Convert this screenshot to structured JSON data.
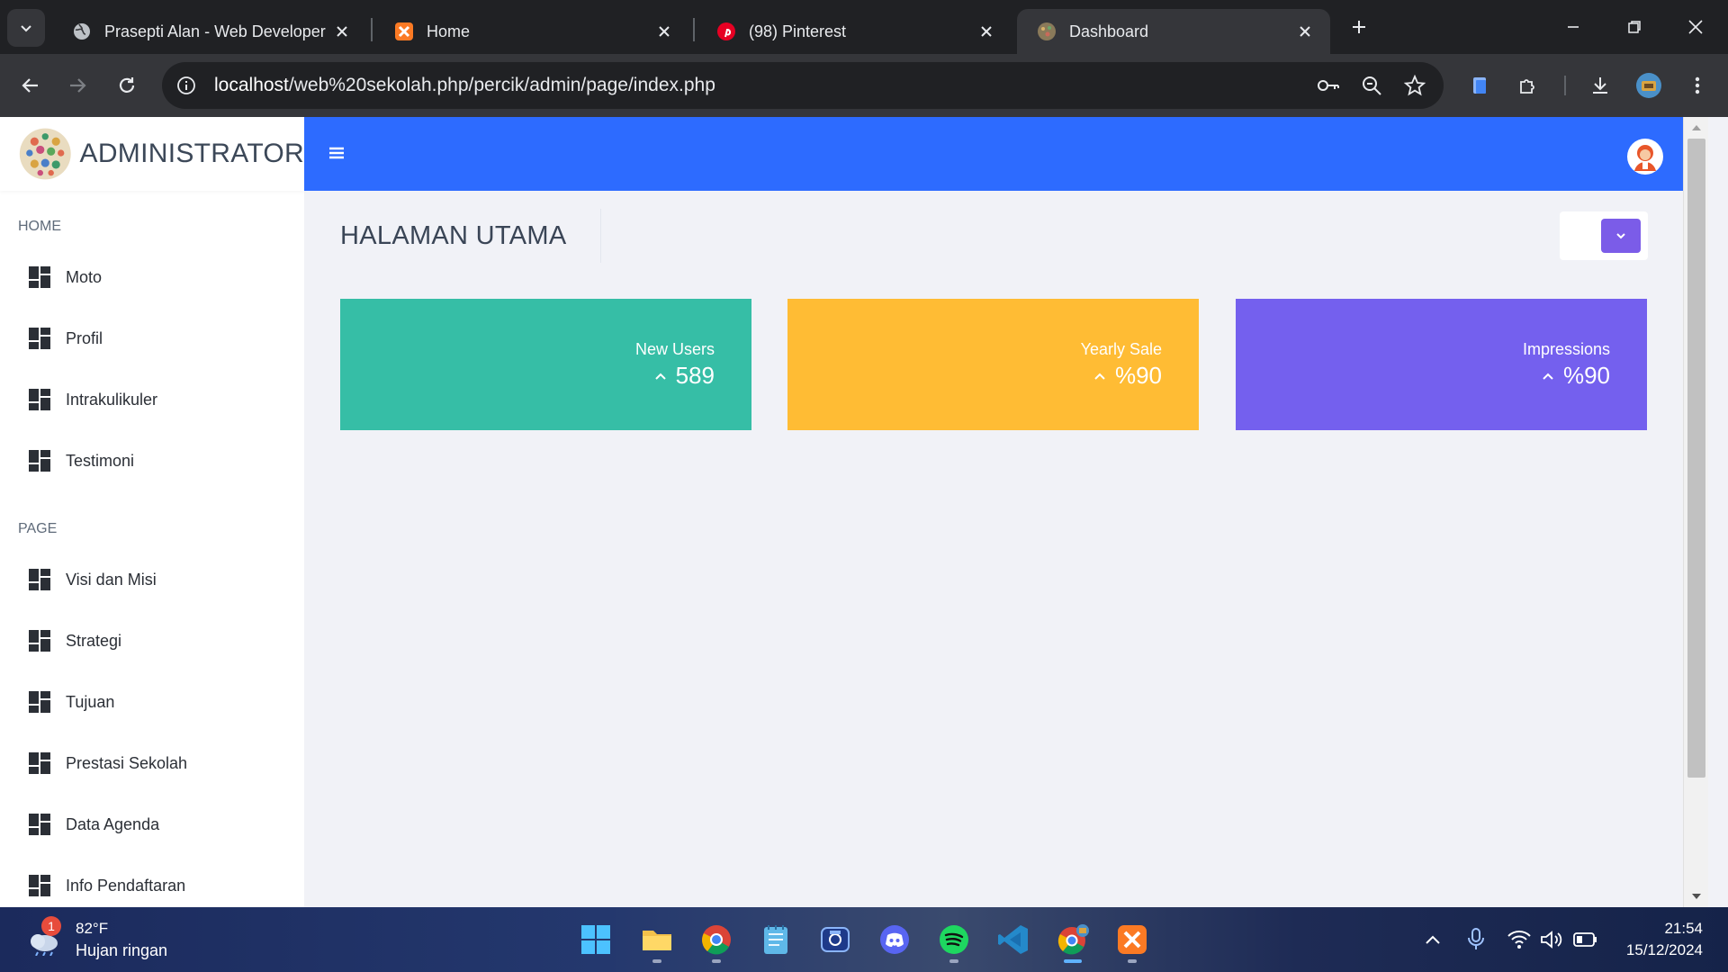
{
  "browser": {
    "tabs": [
      {
        "title": "Prasepti Alan - Web Developer",
        "favicon": "globe-icon",
        "active": false
      },
      {
        "title": "Home",
        "favicon": "xampp-icon",
        "active": false
      },
      {
        "title": "(98) Pinterest",
        "favicon": "pinterest-icon",
        "active": false
      },
      {
        "title": "Dashboard",
        "favicon": "site-logo-icon",
        "active": true
      }
    ],
    "url_host": "localhost",
    "url_path": "/web%20sekolah.php/percik/admin/page/index.php"
  },
  "sidebar": {
    "brand": "ADMINISTRATOR",
    "sections": [
      {
        "label": "HOME",
        "items": [
          "Moto",
          "Profil",
          "Intrakulikuler",
          "Testimoni"
        ]
      },
      {
        "label": "PAGE",
        "items": [
          "Visi dan Misi",
          "Strategi",
          "Tujuan",
          "Prestasi Sekolah",
          "Data Agenda",
          "Info Pendaftaran"
        ]
      }
    ]
  },
  "main": {
    "page_title": "HALAMAN UTAMA",
    "cards": [
      {
        "label": "New Users",
        "value": "589",
        "color": "#36bea6"
      },
      {
        "label": "Yearly Sale",
        "value": "%90",
        "color": "#ffbc34"
      },
      {
        "label": "Impressions",
        "value": "%90",
        "color": "#7460ee"
      }
    ]
  },
  "colors": {
    "topbar": "#2d6bff",
    "page_bg": "#f1f2f7",
    "action_button": "#7b5ce8"
  },
  "taskbar": {
    "weather_temp": "82°F",
    "weather_cond": "Hujan ringan",
    "weather_badge": "1",
    "time": "21:54",
    "date": "15/12/2024",
    "apps": [
      "start-icon",
      "file-explorer-icon",
      "chrome-icon",
      "notepad-icon",
      "capture-icon",
      "discord-icon",
      "spotify-icon",
      "vscode-icon",
      "chrome-profile-icon",
      "xampp-icon"
    ]
  }
}
